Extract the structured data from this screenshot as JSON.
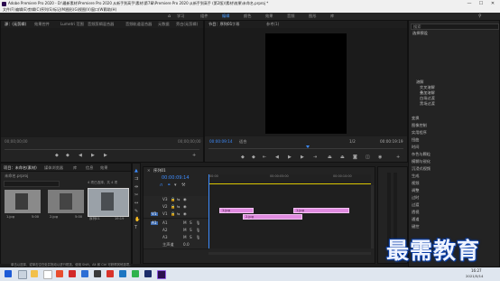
{
  "window": {
    "title": "Adobe Premiere Pro 2020 - D:\\最新素材\\Premiere Pro 2020 从新手到高手\\素材\\第7章\\Premiere Pro 2020 从新手到高手 (第2版)\\素材\\效果\\未命名.prproj *",
    "minimize": "—",
    "maximize": "☐",
    "close": "✕"
  },
  "menu": [
    "文件(F)",
    "编辑(E)",
    "剪辑(C)",
    "序列(S)",
    "标记(M)",
    "图形(G)",
    "视图(V)",
    "窗口(W)",
    "帮助(H)"
  ],
  "workspaces": [
    "学习",
    "组件",
    "编辑",
    "颜色",
    "效果",
    "音频",
    "图形",
    "库"
  ],
  "source_panel": {
    "tabs": [
      "源：(无剪辑)",
      "效果控件",
      "Lumetri 范围",
      "音频剪辑混合器",
      "音频轨道混合器",
      "元数据",
      "旁白(无剪辑)"
    ],
    "timecode_left": "00;00;00;00",
    "timecode_right": "00;00;00;00"
  },
  "program_panel": {
    "tabs": [
      "节目：序列01",
      "字幕",
      "参考(1)"
    ],
    "timecode_current": "00:00:09:14",
    "fit": "适合",
    "resolution": "1/2",
    "timecode_total": "00:00:19:19"
  },
  "project_panel": {
    "tabs": [
      "项目：未命名(素材)",
      "媒体浏览器",
      "库",
      "信息",
      "效果"
    ],
    "project_file": "未命名.prproj",
    "item_count": "4 项已选择，共 4 项",
    "items": [
      {
        "name": "1.jpg",
        "duration": "5:00"
      },
      {
        "name": "2.jpg",
        "duration": "5:00"
      },
      {
        "name": "序列01",
        "duration": "19:19"
      }
    ]
  },
  "timeline": {
    "tab": "序列01",
    "timecode": "00:00:09:14",
    "ruler_labels": [
      "00:00",
      "00:00:05:00",
      "00:00:10:00"
    ],
    "video_tracks": [
      "V3",
      "V2",
      "V1"
    ],
    "audio_tracks": [
      "A1",
      "A2",
      "A3"
    ],
    "master_label": "主声道",
    "master_value": "0.0",
    "clips": [
      "1.jpg",
      "2.jpg",
      "1.jpg"
    ]
  },
  "effects_panel": {
    "search": "搜索",
    "header": "选择预设",
    "preset_items": [
      "预设",
      "Lumetri 预设",
      "音频效果",
      "音频过渡",
      "视频效果",
      "视频过渡"
    ],
    "tree": [
      "溶解",
      "交叉溶解",
      "叠加溶解",
      "白场过渡",
      "黑场过渡"
    ],
    "sections": [
      "变换",
      "图像控制",
      "实用程序",
      "扭曲",
      "时间",
      "杂色与颗粒",
      "模糊与锐化",
      "沉浸式视频",
      "生成",
      "视频",
      "调整",
      "过时",
      "过渡",
      "透视",
      "通道",
      "键控",
      "颜色校正",
      "风格化"
    ]
  },
  "statusbar": {
    "text": "单击以选择，或单击空白处并拖动以进行框选。使用 Shift、Alt 和 Ctrl 可获得其他选项。"
  },
  "taskbar": {
    "time": "16:27",
    "date": "2021/5/14"
  },
  "watermark": "最需教育",
  "colors": {
    "accent": "#3d8cff",
    "clip": "#e08be0",
    "playhead": "#3d8cff",
    "background": "#1d1d1d"
  }
}
